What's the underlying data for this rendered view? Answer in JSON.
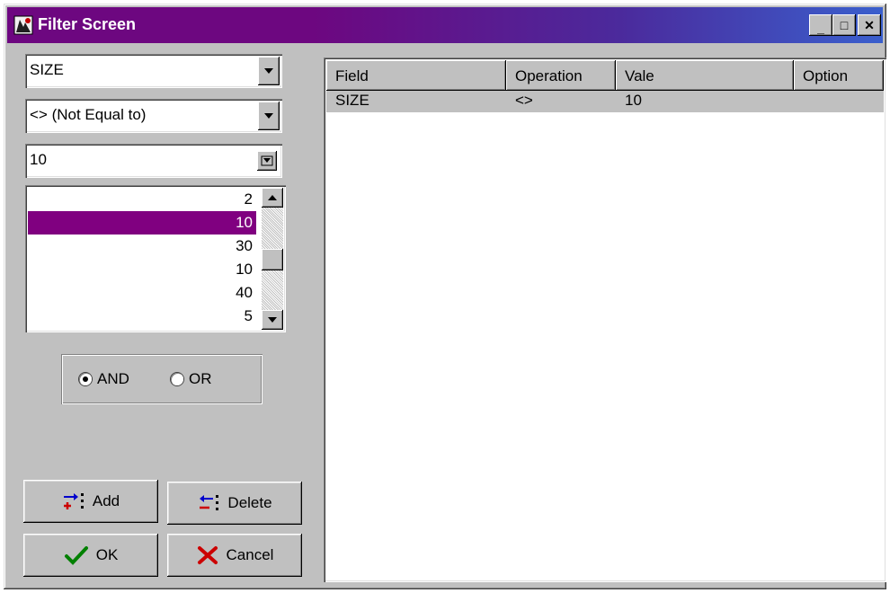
{
  "window": {
    "title": "Filter Screen",
    "controls": {
      "minimize": "_",
      "maximize": "□",
      "close": "✕"
    }
  },
  "filter": {
    "field": "SIZE",
    "operation": "<> (Not Equal to)",
    "value": "10",
    "values_list": [
      "2",
      "10",
      "30",
      "10",
      "40",
      "5"
    ],
    "selected_index": 1
  },
  "logic": {
    "and_label": "AND",
    "or_label": "OR",
    "selected": "AND"
  },
  "buttons": {
    "add": "Add",
    "delete": "Delete",
    "ok": "OK",
    "cancel": "Cancel"
  },
  "grid": {
    "columns": [
      "Field",
      "Operation",
      "Vale",
      "Option"
    ],
    "rows": [
      [
        "SIZE",
        "<>",
        "10",
        ""
      ]
    ]
  },
  "colors": {
    "title_start": "#6d0780",
    "title_end": "#3a5fcd",
    "selection": "#800080",
    "face": "#c0c0c0"
  }
}
